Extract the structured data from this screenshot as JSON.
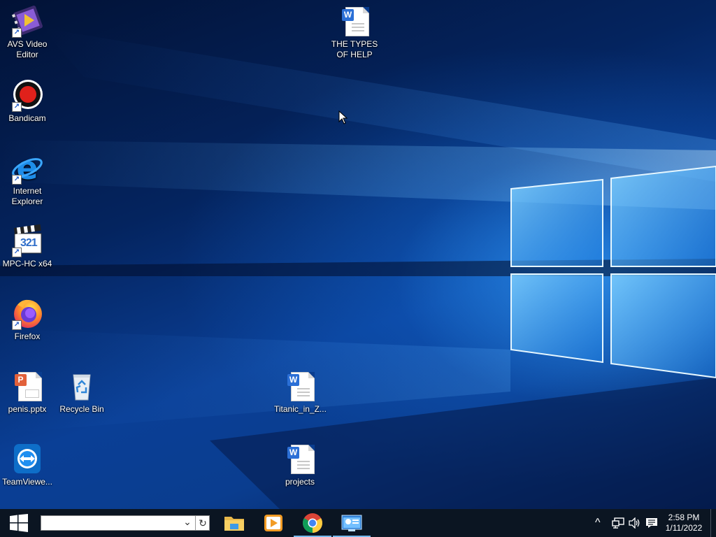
{
  "desktop": {
    "icons": [
      {
        "name": "AVS Video Editor",
        "lines": [
          "AVS Video",
          "Editor"
        ]
      },
      {
        "name": "THE TYPES OF HELP",
        "lines": [
          "THE TYPES",
          "OF HELP"
        ]
      },
      {
        "name": "Bandicam",
        "lines": [
          "Bandicam"
        ]
      },
      {
        "name": "Internet Explorer",
        "lines": [
          "Internet",
          "Explorer"
        ]
      },
      {
        "name": "MPC-HC x64",
        "lines": [
          "MPC-HC x64"
        ],
        "glyph": "321"
      },
      {
        "name": "Firefox",
        "lines": [
          "Firefox"
        ]
      },
      {
        "name": "penis.pptx",
        "lines": [
          "penis.pptx"
        ],
        "badge": "P"
      },
      {
        "name": "Recycle Bin",
        "lines": [
          "Recycle Bin"
        ]
      },
      {
        "name": "Titanic_in_Z...",
        "lines": [
          "Titanic_in_Z..."
        ],
        "badge": "W"
      },
      {
        "name": "TeamViewe...",
        "lines": [
          "TeamViewe..."
        ]
      },
      {
        "name": "projects",
        "lines": [
          "projects"
        ],
        "badge": "W"
      }
    ],
    "word_badge": "W",
    "shortcut_glyph": "↗"
  },
  "taskbar": {
    "search_value": "",
    "refresh_glyph": "↻",
    "dropdown_glyph": "⌄",
    "apps": [
      "file-explorer",
      "media-player",
      "chrome",
      "control-panel"
    ],
    "tray": {
      "chevron_glyph": "^",
      "network_glyph": "🖧",
      "volume_glyph": "🔊",
      "notification_glyph": "🗨"
    },
    "clock": {
      "time": "2:58 PM",
      "date": "1/11/2022"
    }
  },
  "colors": {
    "taskbar_bg": "#0b1522",
    "active_indicator": "#76b9ed",
    "word_blue": "#2b6fd6",
    "ppt_orange": "#e2613b"
  }
}
